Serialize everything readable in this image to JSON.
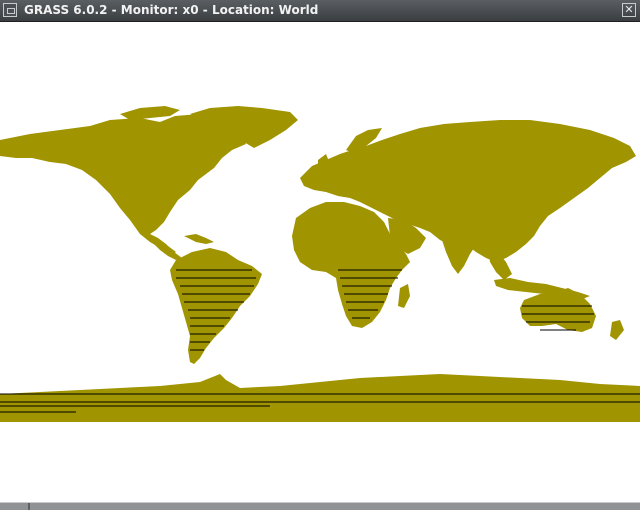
{
  "window": {
    "title": "GRASS 6.0.2 - Monitor: x0 - Location: World",
    "close_symbol": "✕"
  },
  "icons": {
    "window_menu": "window-menu-icon",
    "close": "close-icon"
  },
  "map": {
    "land_color": "#a09400",
    "background_color": "#ffffff",
    "hatch_color": "#000000"
  }
}
